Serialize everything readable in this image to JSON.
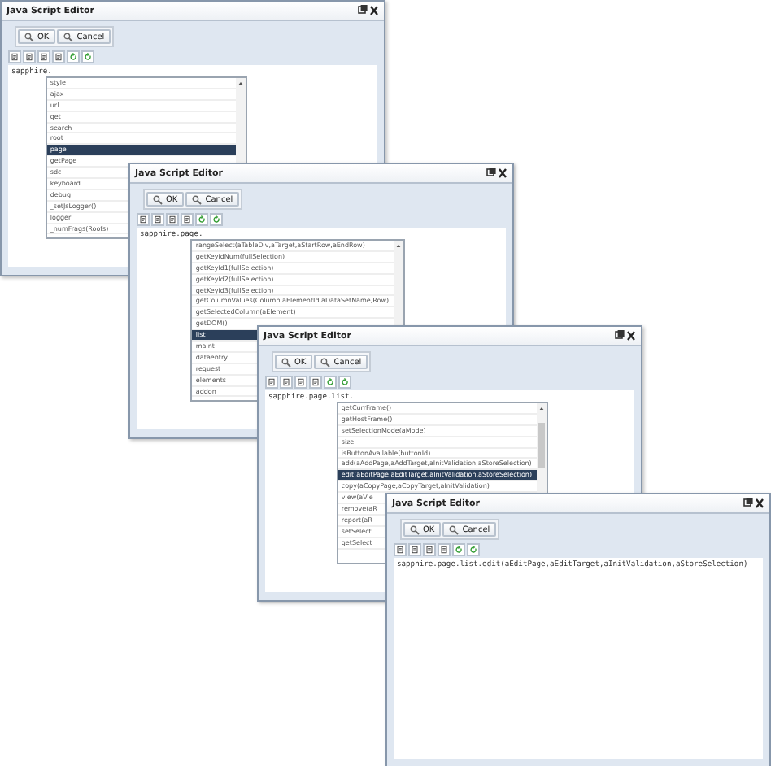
{
  "windows": [
    {
      "title": "Java Script Editor",
      "buttons": [
        "OK",
        "Cancel"
      ],
      "code": "sapphire.",
      "completions": [
        {
          "label": "style",
          "selected": false
        },
        {
          "label": "ajax",
          "selected": false
        },
        {
          "label": "url",
          "selected": false
        },
        {
          "label": "get",
          "selected": false
        },
        {
          "label": "search",
          "selected": false
        },
        {
          "label": "root",
          "selected": false
        },
        {
          "label": "page",
          "selected": true
        },
        {
          "label": "getPage",
          "selected": false
        },
        {
          "label": "sdc",
          "selected": false
        },
        {
          "label": "keyboard",
          "selected": false
        },
        {
          "label": "debug",
          "selected": false
        },
        {
          "label": "_setJsLogger()",
          "selected": false
        },
        {
          "label": "logger",
          "selected": false
        },
        {
          "label": "_numFrags(Roofs)",
          "selected": false
        }
      ]
    },
    {
      "title": "Java Script Editor",
      "buttons": [
        "OK",
        "Cancel"
      ],
      "code": "sapphire.page.",
      "completions": [
        {
          "label": "rangeSelect(aTableDiv,aTarget,aStartRow,aEndRow)",
          "selected": false
        },
        {
          "label": "getKeyIdNum(fullSelection)",
          "selected": false
        },
        {
          "label": "getKeyId1(fullSelection)",
          "selected": false
        },
        {
          "label": "getKeyId2(fullSelection)",
          "selected": false
        },
        {
          "label": "getKeyId3(fullSelection)",
          "selected": false
        },
        {
          "label": "getColumnValues(Column,aElementId,aDataSetName,Row)",
          "selected": false
        },
        {
          "label": "getSelectedColumn(aElement)",
          "selected": false
        },
        {
          "label": "getDOM()",
          "selected": false
        },
        {
          "label": "list",
          "selected": true
        },
        {
          "label": "maint",
          "selected": false
        },
        {
          "label": "dataentry",
          "selected": false
        },
        {
          "label": "request",
          "selected": false
        },
        {
          "label": "elements",
          "selected": false
        },
        {
          "label": "addon",
          "selected": false
        }
      ]
    },
    {
      "title": "Java Script Editor",
      "buttons": [
        "OK",
        "Cancel"
      ],
      "code": "sapphire.page.list.",
      "completions": [
        {
          "label": "getCurrFrame()",
          "selected": false
        },
        {
          "label": "getHostFrame()",
          "selected": false
        },
        {
          "label": "setSelectionMode(aMode)",
          "selected": false
        },
        {
          "label": "size",
          "selected": false
        },
        {
          "label": "isButtonAvailable(buttonId)",
          "selected": false
        },
        {
          "label": "add(aAddPage,aAddTarget,aInitValidation,aStoreSelection)",
          "selected": false
        },
        {
          "label": "edit(aEditPage,aEditTarget,aInitValidation,aStoreSelection)",
          "selected": true
        },
        {
          "label": "copy(aCopyPage,aCopyTarget,aInitValidation)",
          "selected": false
        },
        {
          "label": "view(aVie",
          "selected": false
        },
        {
          "label": "remove(aR",
          "selected": false
        },
        {
          "label": "report(aR",
          "selected": false
        },
        {
          "label": "setSelect",
          "selected": false
        },
        {
          "label": "getSelect",
          "selected": false
        }
      ]
    },
    {
      "title": "Java Script Editor",
      "buttons": [
        "OK",
        "Cancel"
      ],
      "code": "sapphire.page.list.edit(aEditPage,aEditTarget,aInitValidation,aStoreSelection)"
    }
  ]
}
